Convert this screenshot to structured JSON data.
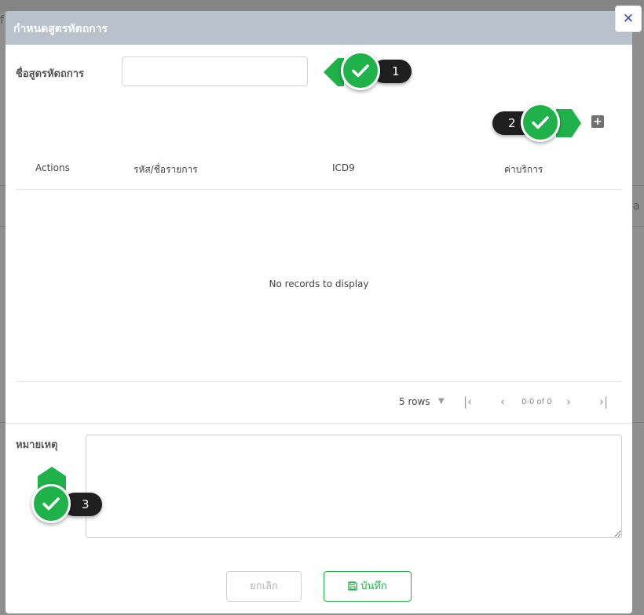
{
  "background": {
    "edge_text_left": "f",
    "edge_text_right": "a"
  },
  "modal": {
    "title": "กำหนดสูตรหัตถการ",
    "close_icon": "close-icon",
    "close_glyph": "✕",
    "name_label": "ชื่อสูตรหัตถการ",
    "name_value": "",
    "add_icon": "plus-square-icon",
    "add_glyph": "+",
    "table": {
      "columns": [
        "Actions",
        "รหัส/ชื่อรายการ",
        "ICD9",
        "ค่าบริการ"
      ],
      "rows": [],
      "empty_message": "No records to display"
    },
    "pagination": {
      "rows_per_page": "5 rows",
      "range": "0-0 of 0"
    },
    "notes_label": "หมายเหตุ",
    "notes_value": "",
    "cancel_label": "ยกเลิก",
    "save_label": "บันทึก",
    "save_icon": "save-icon"
  },
  "callouts": [
    {
      "number": "1",
      "icon": "check-icon"
    },
    {
      "number": "2",
      "icon": "check-icon"
    },
    {
      "number": "3",
      "icon": "check-icon"
    }
  ],
  "colors": {
    "header": "#b9c2ca",
    "accent_green": "#24b04b",
    "callout_green": "#1fb24a",
    "callout_dark": "#1f1f1f",
    "close_icon": "#3d4ab0"
  }
}
